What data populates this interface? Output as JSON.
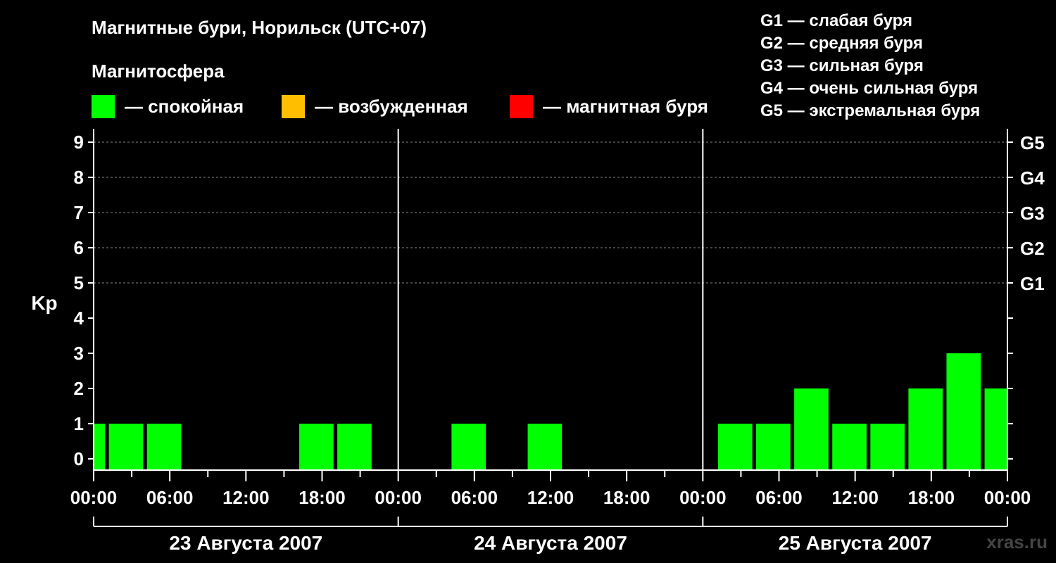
{
  "title": "Магнитные бури, Норильск (UTC+07)",
  "subtitle": "Магнитосфера",
  "legend": [
    {
      "label": "— спокойная",
      "color": "#00ff00"
    },
    {
      "label": "— возбужденная",
      "color": "#ffbf00"
    },
    {
      "label": "— магнитная буря",
      "color": "#ff0000"
    }
  ],
  "storm_scale": [
    "G1 — слабая буря",
    "G2 — средняя буря",
    "G3 — сильная буря",
    "G4 — очень сильная буря",
    "G5 — экстремальная буря"
  ],
  "watermark": "xras.ru",
  "chart_data": {
    "type": "bar",
    "ylabel": "Kp",
    "ylim": [
      0,
      9
    ],
    "yticks": [
      0,
      1,
      2,
      3,
      4,
      5,
      6,
      7,
      8,
      9
    ],
    "right_axis_labels": [
      {
        "kp": 5,
        "label": "G1"
      },
      {
        "kp": 6,
        "label": "G2"
      },
      {
        "kp": 7,
        "label": "G3"
      },
      {
        "kp": 8,
        "label": "G4"
      },
      {
        "kp": 9,
        "label": "G5"
      }
    ],
    "x_tick_labels": [
      "00:00",
      "06:00",
      "12:00",
      "18:00",
      "00:00",
      "06:00",
      "12:00",
      "18:00",
      "00:00",
      "06:00",
      "12:00",
      "18:00",
      "00:00"
    ],
    "days": [
      "23 Августа 2007",
      "24 Августа 2007",
      "25 Августа 2007"
    ],
    "grid": "dashed horizontal at G levels",
    "bars": [
      {
        "day": 0,
        "start_hour": 0,
        "end_hour": 0.9,
        "kp": 1,
        "color": "#00ff00"
      },
      {
        "day": 0,
        "start_hour": 1.2,
        "end_hour": 3.9,
        "kp": 1,
        "color": "#00ff00"
      },
      {
        "day": 0,
        "start_hour": 4.2,
        "end_hour": 6.9,
        "kp": 1,
        "color": "#00ff00"
      },
      {
        "day": 0,
        "start_hour": 16.2,
        "end_hour": 18.9,
        "kp": 1,
        "color": "#00ff00"
      },
      {
        "day": 0,
        "start_hour": 19.2,
        "end_hour": 21.9,
        "kp": 1,
        "color": "#00ff00"
      },
      {
        "day": 1,
        "start_hour": 4.2,
        "end_hour": 6.9,
        "kp": 1,
        "color": "#00ff00"
      },
      {
        "day": 1,
        "start_hour": 10.2,
        "end_hour": 12.9,
        "kp": 1,
        "color": "#00ff00"
      },
      {
        "day": 2,
        "start_hour": 1.2,
        "end_hour": 3.9,
        "kp": 1,
        "color": "#00ff00"
      },
      {
        "day": 2,
        "start_hour": 4.2,
        "end_hour": 6.9,
        "kp": 1,
        "color": "#00ff00"
      },
      {
        "day": 2,
        "start_hour": 7.2,
        "end_hour": 9.9,
        "kp": 2,
        "color": "#00ff00"
      },
      {
        "day": 2,
        "start_hour": 10.2,
        "end_hour": 12.9,
        "kp": 1,
        "color": "#00ff00"
      },
      {
        "day": 2,
        "start_hour": 13.2,
        "end_hour": 15.9,
        "kp": 1,
        "color": "#00ff00"
      },
      {
        "day": 2,
        "start_hour": 16.2,
        "end_hour": 18.9,
        "kp": 2,
        "color": "#00ff00"
      },
      {
        "day": 2,
        "start_hour": 19.2,
        "end_hour": 21.9,
        "kp": 3,
        "color": "#00ff00"
      },
      {
        "day": 2,
        "start_hour": 22.2,
        "end_hour": 24,
        "kp": 2,
        "color": "#00ff00"
      }
    ]
  }
}
